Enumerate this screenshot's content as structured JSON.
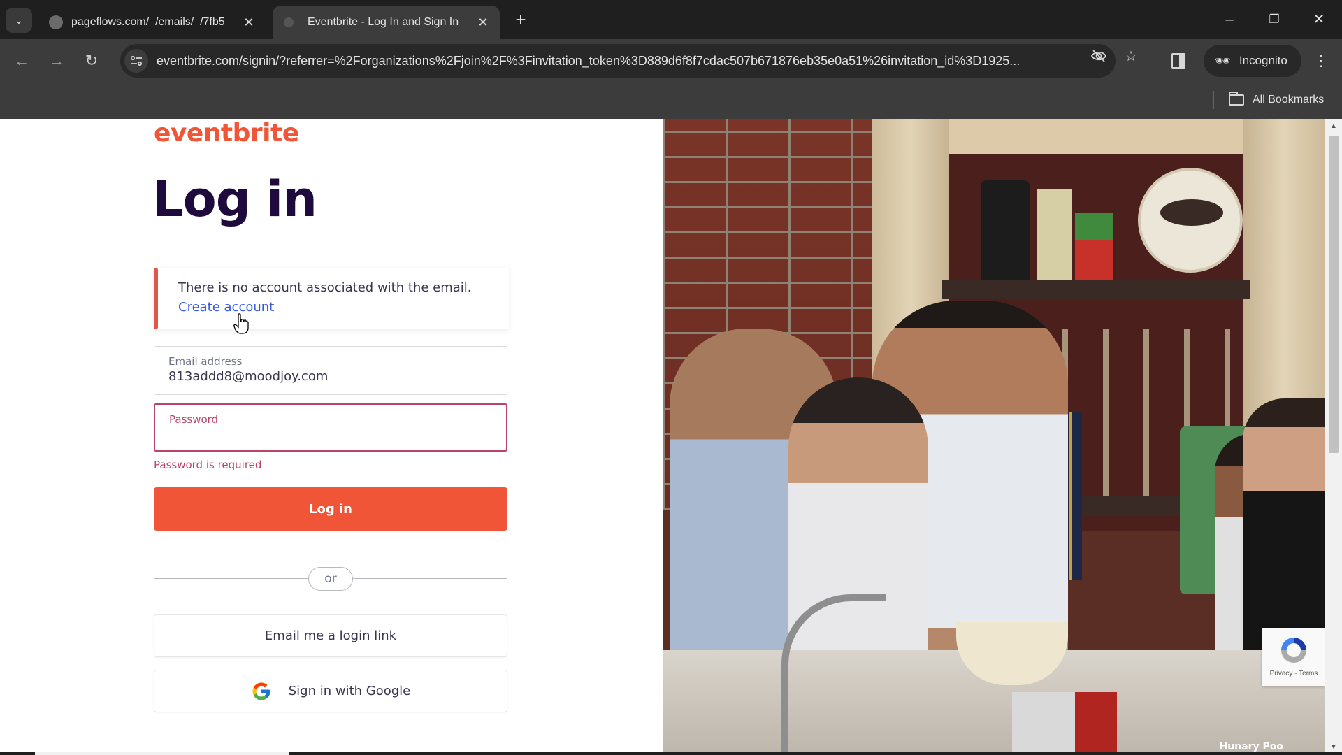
{
  "browser": {
    "tabs": [
      {
        "title": "pageflows.com/_/emails/_/7fb5",
        "active": false
      },
      {
        "title": "Eventbrite - Log In and Sign In",
        "active": true
      }
    ],
    "new_tab_label": "+",
    "url": "eventbrite.com/signin/?referrer=%2Forganizations%2Fjoin%2F%3Finvitation_token%3D889d6f8f7cdac507b671876eb35e0a51%26invitation_id%3D1925...",
    "incognito_label": "Incognito",
    "bookmarks_label": "All Bookmarks",
    "icons": {
      "tab_search": "chevron-down-icon",
      "back": "arrow-left-icon",
      "forward": "arrow-right-icon",
      "reload": "reload-icon",
      "site_info": "tune-icon",
      "eye_off": "eye-off-icon",
      "bookmark_star": "star-icon",
      "side_panel": "side-panel-icon",
      "incognito": "incognito-icon",
      "menu": "kebab-menu-icon",
      "folder": "folder-icon"
    },
    "window_controls": {
      "minimize": "–",
      "restore": "❐",
      "close": "✕"
    }
  },
  "page": {
    "brand": {
      "logo_text": "eventbrite",
      "color": "#f05537"
    },
    "title": "Log in",
    "alert": {
      "message": "There is no account associated with the email.",
      "link_label": "Create account",
      "accent_color": "#e0574a"
    },
    "email_field": {
      "label": "Email address",
      "value": "813addd8@moodjoy.com"
    },
    "password_field": {
      "label": "Password",
      "value": "",
      "error": "Password is required"
    },
    "login_button": "Log in",
    "divider_label": "or",
    "email_link_button": "Email me a login link",
    "google_button": "Sign in with Google",
    "photo_credit": "Hunary Poo",
    "recaptcha": {
      "links": "Privacy - Terms"
    }
  },
  "colors": {
    "primary": "#f05537",
    "heading": "#1e0a3c",
    "error": "#b94467",
    "link": "#3659e3"
  }
}
